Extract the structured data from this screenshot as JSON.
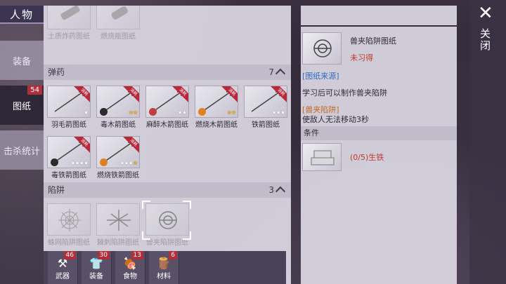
{
  "title": "人物",
  "side_tabs": [
    {
      "label": "装备",
      "badge": ""
    },
    {
      "label": "图纸",
      "badge": "54"
    },
    {
      "label": "击杀统计",
      "badge": ""
    }
  ],
  "top_items": [
    {
      "label": "土质炸药图纸"
    },
    {
      "label": "燃烧瓶图纸"
    }
  ],
  "sections": [
    {
      "name": "弹药",
      "count": "7"
    },
    {
      "name": "陷阱",
      "count": "3"
    }
  ],
  "ribbon_text": "消耗",
  "ammo_items": [
    {
      "label": "羽毛箭图纸",
      "gold": 0,
      "white": 1,
      "elem": ""
    },
    {
      "label": "毒木箭图纸",
      "gold": 2,
      "white": 0,
      "elem": "dark"
    },
    {
      "label": "麻醉木箭图纸",
      "gold": 0,
      "white": 2,
      "elem": "red"
    },
    {
      "label": "燃烧木箭图纸",
      "gold": 2,
      "white": 0,
      "elem": "fire"
    },
    {
      "label": "铁箭图纸",
      "gold": 0,
      "white": 3,
      "elem": ""
    },
    {
      "label": "毒铁箭图纸",
      "gold": 0,
      "white": 4,
      "elem": "dark"
    },
    {
      "label": "燃烧铁箭图纸",
      "gold": 1,
      "white": 3,
      "elem": "fire"
    }
  ],
  "trap_items": [
    {
      "label": "蛛网陷阱图纸"
    },
    {
      "label": "棘刺陷阱图纸"
    },
    {
      "label": "兽夹陷阱图纸"
    }
  ],
  "categories": [
    {
      "label": "武器",
      "badge": "46",
      "icon": "axe-icon",
      "glyph": "⚒"
    },
    {
      "label": "装备",
      "badge": "30",
      "icon": "shirt-icon",
      "glyph": "👕"
    },
    {
      "label": "食物",
      "badge": "13",
      "icon": "food-icon",
      "glyph": "🍖"
    },
    {
      "label": "材料",
      "badge": "6",
      "icon": "wood-icon",
      "glyph": "🪵"
    }
  ],
  "detail": {
    "name": "兽夹陷阱图纸",
    "status": "未习得",
    "source": "[图纸来源]",
    "desc": "学习后可以制作兽夹陷阱",
    "tag": "[兽夹陷阱]",
    "effect": "使敌人无法移动3秒",
    "conditions_title": "条件",
    "material": "(0/5)生铁"
  },
  "close": {
    "symbol": "✕",
    "label": "关闭"
  },
  "colors": {
    "ribbon": "#b8283a",
    "badge": "#b0303a",
    "status_red": "#c0392b",
    "link_blue": "#2e6fc0",
    "tag_orange": "#c06a20"
  }
}
